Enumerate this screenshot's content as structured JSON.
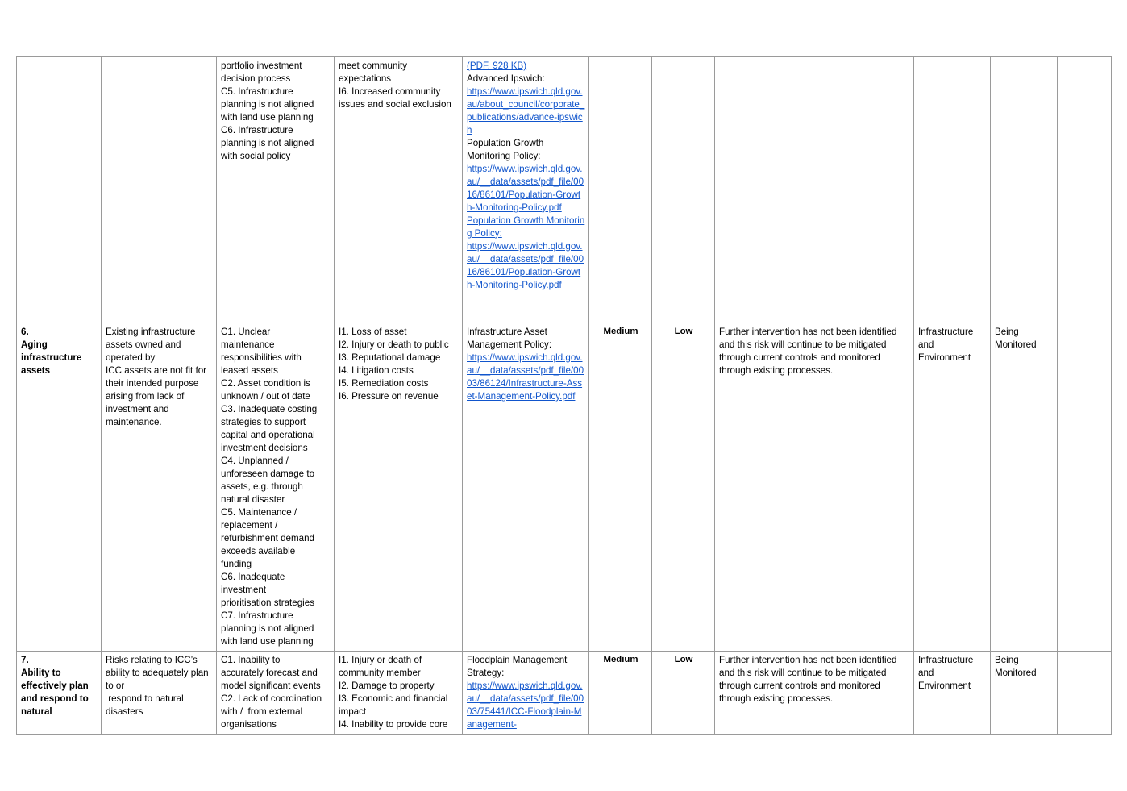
{
  "document": {
    "type": "risk-register-table",
    "page_background": "#ffffff",
    "colors": {
      "id_column_fill": "#bdd7ee",
      "medium_rating_fill": "#ffff00",
      "low_rating_fill": "#00a14b",
      "link_color": "#1155cc",
      "border_color": "#9a9a9a"
    }
  },
  "rows": [
    {
      "id_label": "",
      "description": "",
      "causes": [
        "portfolio investment",
        "decision process",
        "C5. Infrastructure",
        "planning is not aligned",
        "with land use planning",
        "C6. Infrastructure",
        "planning is not aligned",
        "with social policy"
      ],
      "impacts": [
        "meet community",
        "expectations",
        "I6. Increased community",
        "issues and social exclusion"
      ],
      "controls": [
        {
          "kind": "link",
          "text": "(PDF, 928 KB)"
        },
        {
          "kind": "label",
          "text": "Advanced Ipswich:"
        },
        {
          "kind": "link",
          "text": "https://www.ipswich.qld.gov.au/about_council/corporate_publications/advance-ipswich"
        },
        {
          "kind": "label",
          "text": "Population Growth Monitoring Policy:"
        },
        {
          "kind": "link",
          "text": "https://www.ipswich.qld.gov.au/__data/assets/pdf_file/0016/86101/Population-Growth-Monitoring-Policy.pdf"
        },
        {
          "kind": "link",
          "text": "Population Growth Monitoring Policy:"
        },
        {
          "kind": "link",
          "text": "https://www.ipswich.qld.gov.au/__data/assets/pdf_file/0016/86101/Population-Growth-Monitoring-Policy.pdf"
        }
      ],
      "inherent_rating": "",
      "residual_rating": "",
      "treatment": "",
      "owner": "",
      "status": "",
      "extra": ""
    },
    {
      "id_label": "6.\nAging infrastructure assets",
      "description": "Existing infrastructure assets owned and operated by\nICC assets are not fit for their intended purpose arising from lack of investment and maintenance.",
      "causes": [
        "C1. Unclear",
        "maintenance",
        "responsibilities with",
        "leased assets",
        "C2. Asset condition is",
        "unknown / out of date",
        "C3. Inadequate costing",
        "strategies to support",
        "capital and operational",
        "investment decisions",
        "C4. Unplanned /",
        "unforeseen damage to",
        "assets, e.g. through",
        "natural disaster",
        "C5. Maintenance /",
        "replacement /",
        "refurbishment demand",
        "exceeds available",
        "funding",
        "C6. Inadequate",
        "investment",
        "prioritisation strategies",
        "C7. Infrastructure",
        "planning is not aligned",
        "with land use planning"
      ],
      "impacts": [
        "I1. Loss of asset",
        "I2. Injury or death to public",
        "I3. Reputational damage",
        "I4. Litigation costs",
        "I5. Remediation costs",
        "I6. Pressure on revenue"
      ],
      "controls": [
        {
          "kind": "label",
          "text": "Infrastructure Asset Management Policy:"
        },
        {
          "kind": "link",
          "text": "https://www.ipswich.qld.gov.au/__data/assets/pdf_file/0003/86124/Infrastructure-Asset-Management-Policy.pdf"
        }
      ],
      "inherent_rating": "Medium",
      "residual_rating": "Low",
      "treatment": "Further intervention has not been identified and this risk will continue to be mitigated through current controls and monitored through existing processes.",
      "owner": "Infrastructure and Environment",
      "status": "Being Monitored",
      "extra": ""
    },
    {
      "id_label": "7.\nAbility to effectively plan and respond to natural",
      "description": "Risks relating to ICC’s ability to adequately plan to or\n respond to natural disasters",
      "causes": [
        "C1. Inability to",
        "accurately forecast and",
        "model significant events",
        "C2. Lack of coordination",
        "with /  from external",
        "organisations"
      ],
      "impacts": [
        "I1. Injury or death of",
        "community member",
        "I2. Damage to property",
        "I3. Economic and financial",
        "impact",
        "I4. Inability to provide core"
      ],
      "controls": [
        {
          "kind": "label",
          "text": "Floodplain Management Strategy:"
        },
        {
          "kind": "link",
          "text": "https://www.ipswich.qld.gov.au/__data/assets/pdf_file/0003/75441/ICC-Floodplain-Management-"
        }
      ],
      "inherent_rating": "Medium",
      "residual_rating": "Low",
      "treatment": "Further intervention has not been identified and this risk will continue to be mitigated through current controls and monitored through existing processes.",
      "owner": "Infrastructure and Environment",
      "status": "Being Monitored",
      "extra": ""
    }
  ]
}
